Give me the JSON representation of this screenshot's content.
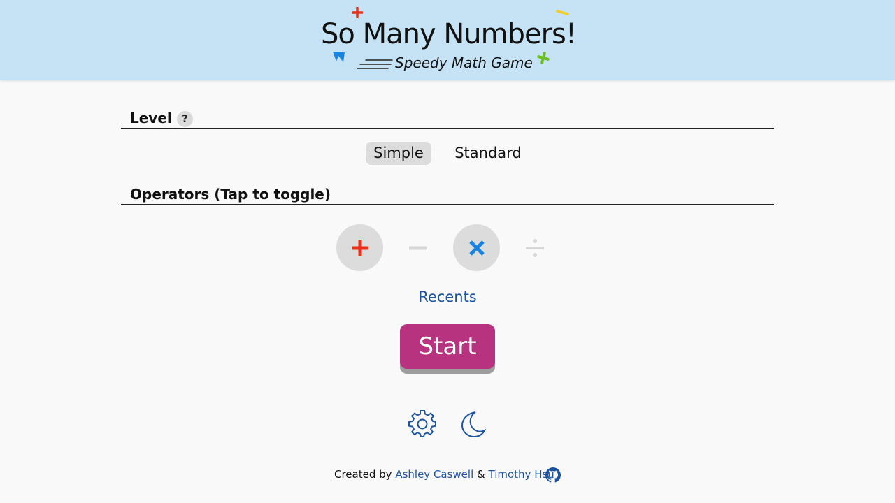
{
  "header": {
    "title": "So Many Numbers!",
    "subtitle": "Speedy Math Game"
  },
  "level": {
    "heading": "Level",
    "help": "?",
    "options": [
      "Simple",
      "Standard"
    ],
    "selected": "Simple"
  },
  "operators": {
    "heading": "Operators (Tap to toggle)",
    "items": [
      {
        "name": "plus",
        "enabled": true,
        "color": "#e8311b"
      },
      {
        "name": "minus",
        "enabled": false,
        "color": "#d6d6d6"
      },
      {
        "name": "times",
        "enabled": true,
        "color": "#1a83e0"
      },
      {
        "name": "divide",
        "enabled": false,
        "color": "#d6d6d6"
      }
    ]
  },
  "recents_label": "Recents",
  "start_label": "Start",
  "icons": {
    "settings": "gear-icon",
    "theme": "moon-icon",
    "repo": "github-icon"
  },
  "footer": {
    "prefix": "Created by",
    "author1": "Ashley Caswell",
    "separator": "&",
    "author2": "Timothy Hsu"
  },
  "colors": {
    "header_bg": "#c5e3f5",
    "accent": "#b7337f",
    "link": "#1c55a0"
  }
}
